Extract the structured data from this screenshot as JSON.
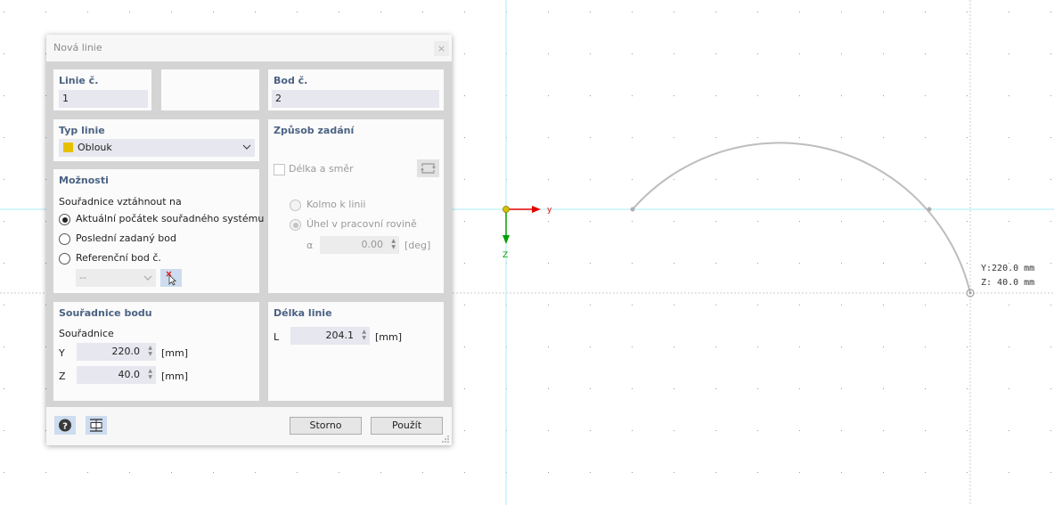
{
  "dialog": {
    "title": "Nová linie",
    "close_glyph": "×",
    "line_no": {
      "label": "Linie č.",
      "value": "1"
    },
    "point_no": {
      "label": "Bod č.",
      "value": "2"
    },
    "line_type": {
      "label": "Typ linie",
      "value": "Oblouk",
      "swatch_color": "#e8c000"
    },
    "options": {
      "header": "Možnosti",
      "relate_label": "Souřadnice vztáhnout na",
      "radios": [
        "Aktuální počátek souřadného systému",
        "Poslední zadaný bod",
        "Referenční bod č."
      ],
      "selected": 0,
      "ref_select_value": "--"
    },
    "input_mode": {
      "header": "Způsob zadání",
      "length_direction_label": "Délka a směr",
      "perpendicular_label": "Kolmo k linii",
      "angle_label": "Úhel v pracovní rovině",
      "alpha_symbol": "α",
      "alpha_value": "0.00",
      "alpha_unit": "[deg]"
    },
    "point_coords": {
      "header": "Souřadnice bodu",
      "sub_label": "Souřadnice",
      "y_label": "Y",
      "y_value": "220.0",
      "y_unit": "[mm]",
      "z_label": "Z",
      "z_value": "40.0",
      "z_unit": "[mm]"
    },
    "line_length": {
      "header": "Délka linie",
      "l_label": "L",
      "l_value": "204.1",
      "l_unit": "[mm]"
    },
    "buttons": {
      "cancel": "Storno",
      "apply": "Použít"
    }
  },
  "viewport": {
    "axis_y_label": "y",
    "axis_z_label": "Z",
    "readout_y": "Y:220.0 mm",
    "readout_z": "Z: 40.0 mm",
    "colors": {
      "axis_y": "#e00000",
      "axis_z": "#00a000",
      "origin": "#d8c000",
      "arc": "#bdbdbd",
      "guide": "#a8ecf4"
    }
  }
}
